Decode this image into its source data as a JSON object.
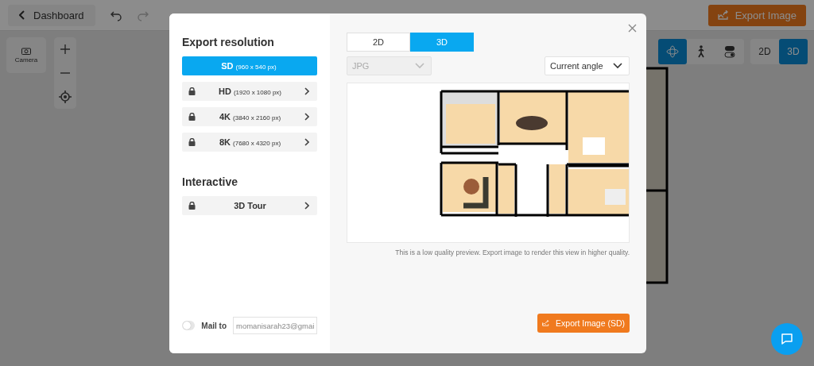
{
  "app": {
    "back_button": "Dashboard",
    "export_button": "Export Image",
    "camera_button": "Camera",
    "nav_modes": [
      {
        "kind": "orbit",
        "selected": true
      },
      {
        "kind": "walk",
        "selected": false
      },
      {
        "kind": "toggle",
        "selected": false
      }
    ],
    "view_tabs": [
      {
        "label": "2D",
        "selected": false
      },
      {
        "label": "3D",
        "selected": true
      }
    ]
  },
  "dialog": {
    "resolution_heading": "Export resolution",
    "resolutions": [
      {
        "name": "SD",
        "size": "(960 x 540 px)",
        "selected": true,
        "locked": false
      },
      {
        "name": "HD",
        "size": "(1920 x 1080 px)",
        "selected": false,
        "locked": true
      },
      {
        "name": "4K",
        "size": "(3840 x 2160 px)",
        "selected": false,
        "locked": true
      },
      {
        "name": "8K",
        "size": "(7680 x 4320 px)",
        "selected": false,
        "locked": true
      }
    ],
    "interactive_heading": "Interactive",
    "interactive_options": [
      {
        "name": "3D Tour",
        "selected": false,
        "locked": true
      }
    ],
    "mail": {
      "label": "Mail to",
      "on": false,
      "value": "momanisarah23@gmai"
    },
    "view_tabs": [
      {
        "label": "2D",
        "selected": false
      },
      {
        "label": "3D",
        "selected": true
      }
    ],
    "format": {
      "value": "JPG",
      "disabled": true
    },
    "angle": {
      "value": "Current angle"
    },
    "preview_note": "This is a low quality preview. Export image to render this view in higher quality.",
    "export_button": "Export Image (SD)"
  }
}
